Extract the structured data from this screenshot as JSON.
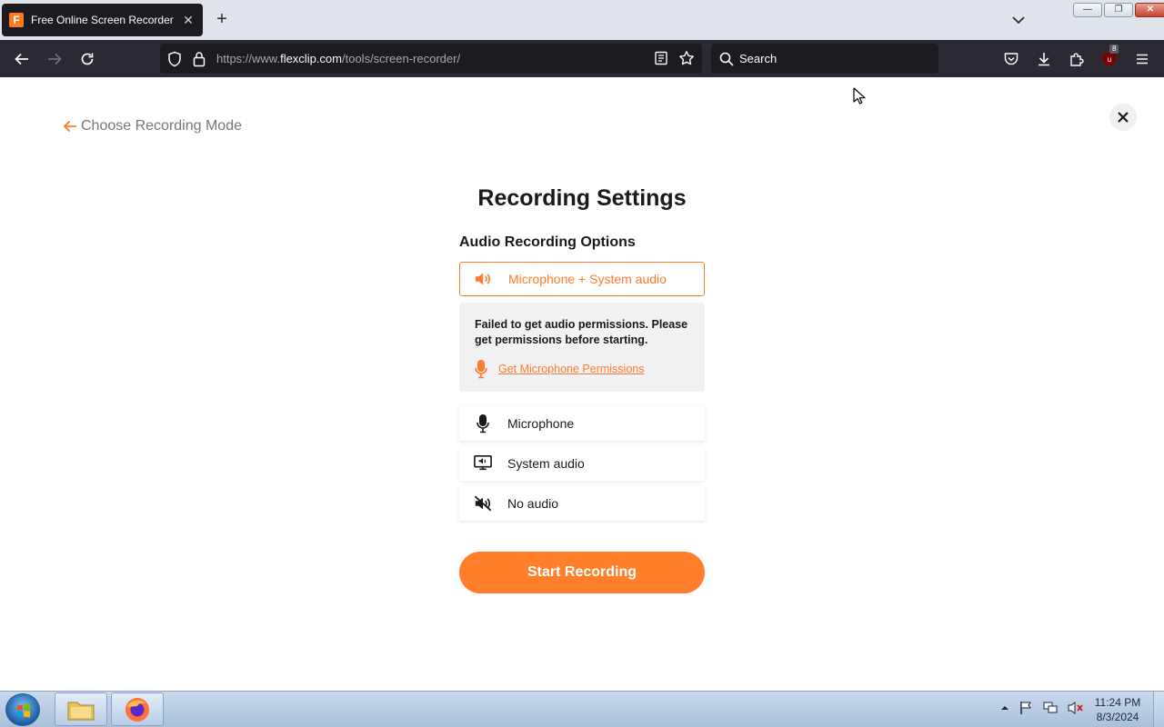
{
  "browser": {
    "tab": {
      "favicon_letter": "F",
      "title": "Free Online Screen Recorder & ",
      "close_glyph": "✕"
    },
    "new_tab_glyph": "+",
    "url": {
      "prefix": "https://www.",
      "domain": "flexclip.com",
      "path": "/tools/screen-recorder/"
    },
    "search": {
      "placeholder": "Search"
    },
    "extension_badge": "8",
    "window_controls": {
      "minimize": "—",
      "restore": "❐",
      "close": "✕"
    }
  },
  "page": {
    "back_label": "Choose Recording Mode",
    "title": "Recording Settings",
    "section_label": "Audio Recording Options",
    "selected_option": {
      "label": "Microphone + System audio",
      "icon": "speaker-icon"
    },
    "permission": {
      "message": "Failed to get audio permissions. Please get permissions before starting.",
      "link_label": "Get Microphone Permissions",
      "icon": "microphone-icon"
    },
    "options": [
      {
        "label": "Microphone",
        "icon": "microphone-icon"
      },
      {
        "label": "System audio",
        "icon": "monitor-speaker-icon"
      },
      {
        "label": "No audio",
        "icon": "mute-icon"
      }
    ],
    "start_button": "Start Recording",
    "accent_color": "#ff7b2c"
  },
  "taskbar": {
    "clock_time": "11:24 PM",
    "clock_date": "8/3/2024"
  }
}
